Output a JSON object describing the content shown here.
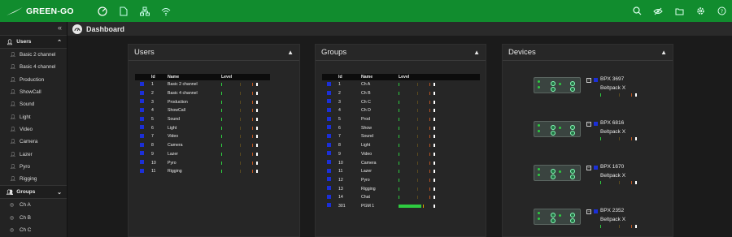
{
  "app": {
    "logo_text": "GREEN-GO",
    "brand_color": "#118c2e"
  },
  "topbar": {
    "nav_icons": [
      "gauge-icon",
      "document-icon",
      "network-icon",
      "wifi-icon"
    ],
    "right_icons": [
      "search-icon",
      "eye-off-icon",
      "folder-icon",
      "gear-icon",
      "help-icon"
    ]
  },
  "header": {
    "title": "Dashboard"
  },
  "sidebar": {
    "users_label": "Users",
    "users": [
      "Basic 2 channel",
      "Basic 4 channel",
      "Production",
      "ShowCall",
      "Sound",
      "Light",
      "Video",
      "Camera",
      "Lazer",
      "Pyro",
      "Rigging"
    ],
    "groups_label": "Groups",
    "groups": [
      "Ch A",
      "Ch B",
      "Ch C"
    ]
  },
  "users_panel": {
    "title": "Users",
    "columns": [
      "",
      "Id",
      "Name",
      "Level"
    ],
    "rows": [
      {
        "id": "1",
        "name": "Basic 2 channel"
      },
      {
        "id": "2",
        "name": "Basic 4 channel"
      },
      {
        "id": "3",
        "name": "Production"
      },
      {
        "id": "4",
        "name": "ShowCall"
      },
      {
        "id": "5",
        "name": "Sound"
      },
      {
        "id": "6",
        "name": "Light"
      },
      {
        "id": "7",
        "name": "Video"
      },
      {
        "id": "8",
        "name": "Camera"
      },
      {
        "id": "9",
        "name": "Lazer"
      },
      {
        "id": "10",
        "name": "Pyro"
      },
      {
        "id": "11",
        "name": "Rigging"
      }
    ]
  },
  "groups_panel": {
    "title": "Groups",
    "columns": [
      "",
      "Id",
      "Name",
      "Level"
    ],
    "rows": [
      {
        "id": "1",
        "name": "Ch A"
      },
      {
        "id": "2",
        "name": "Ch B"
      },
      {
        "id": "3",
        "name": "Ch C"
      },
      {
        "id": "4",
        "name": "Ch D"
      },
      {
        "id": "5",
        "name": "Prod"
      },
      {
        "id": "6",
        "name": "Show"
      },
      {
        "id": "7",
        "name": "Sound"
      },
      {
        "id": "8",
        "name": "Light"
      },
      {
        "id": "9",
        "name": "Video"
      },
      {
        "id": "10",
        "name": "Camera"
      },
      {
        "id": "11",
        "name": "Lazer"
      },
      {
        "id": "12",
        "name": "Pyro"
      },
      {
        "id": "13",
        "name": "Rigging"
      },
      {
        "id": "14",
        "name": "Chat"
      },
      {
        "id": "301",
        "name": "PGM 1"
      }
    ]
  },
  "devices_panel": {
    "title": "Devices",
    "devices": [
      {
        "name": "BPX 3697",
        "type": "Beltpack X"
      },
      {
        "name": "BPX 6816",
        "type": "Beltpack X"
      },
      {
        "name": "BPX 1670",
        "type": "Beltpack X"
      },
      {
        "name": "BPX 2352",
        "type": "Beltpack X"
      }
    ]
  }
}
